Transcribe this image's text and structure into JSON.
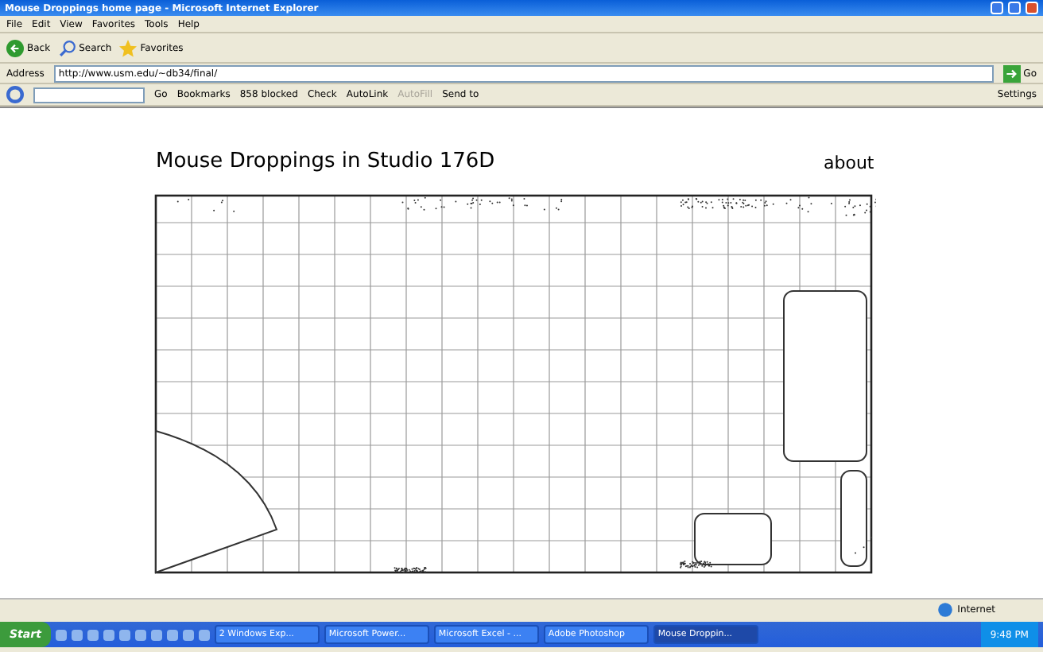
{
  "window": {
    "title": "Mouse Droppings home page - Microsoft Internet Explorer"
  },
  "menu": [
    "File",
    "Edit",
    "View",
    "Favorites",
    "Tools",
    "Help"
  ],
  "toolbar": [
    {
      "kind": "back",
      "label": "Back"
    },
    {
      "kind": "search",
      "label": "Search"
    },
    {
      "kind": "favorites",
      "label": "Favorites"
    }
  ],
  "address": {
    "label": "Address",
    "value": "http://www.usm.edu/~db34/final/",
    "go": "Go"
  },
  "google_bar": {
    "go": "Go",
    "items": [
      {
        "label": "Bookmarks",
        "disabled": false
      },
      {
        "label": "858 blocked",
        "disabled": false
      },
      {
        "label": "Check",
        "disabled": false
      },
      {
        "label": "AutoLink",
        "disabled": false
      },
      {
        "label": "AutoFill",
        "disabled": true
      },
      {
        "label": "Send to",
        "disabled": false
      }
    ],
    "settings": "Settings"
  },
  "page": {
    "title": "Mouse Droppings in Studio 176D",
    "link": "about"
  },
  "status_bar": {
    "zone": "Internet"
  },
  "taskbar": {
    "start": "Start",
    "tasks": [
      {
        "label": "2 Windows Exp...",
        "selected": false
      },
      {
        "label": "Microsoft Power...",
        "selected": false
      },
      {
        "label": "Microsoft Excel - ...",
        "selected": false
      },
      {
        "label": "Adobe Photoshop",
        "selected": false
      },
      {
        "label": "Mouse Droppin...",
        "selected": true
      }
    ],
    "clock": "9:48 PM"
  }
}
